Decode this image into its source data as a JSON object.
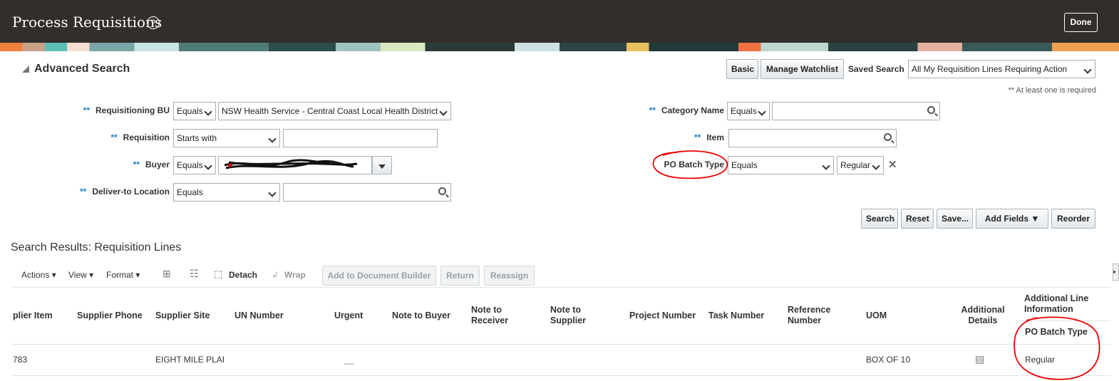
{
  "header": {
    "title": "Process Requisitions",
    "done_label": "Done"
  },
  "search": {
    "title": "Advanced Search",
    "basic_label": "Basic",
    "watchlist_label": "Manage Watchlist",
    "saved_search_label": "Saved Search",
    "saved_search_value": "All My Requisition Lines Requiring Action",
    "required_note": "** At least one is required",
    "required_marker": "**",
    "fields": {
      "req_bu": {
        "label": "Requisitioning BU",
        "operator": "Equals",
        "value": "NSW Health Service - Central Coast Local Health District"
      },
      "requisition": {
        "label": "Requisition",
        "operator": "Starts with",
        "value": ""
      },
      "buyer": {
        "label": "Buyer",
        "operator": "Equals",
        "value": ""
      },
      "deliver_to": {
        "label": "Deliver-to Location",
        "operator": "Equals",
        "value": ""
      },
      "category": {
        "label": "Category Name",
        "operator": "Equals",
        "value": ""
      },
      "item": {
        "label": "Item",
        "value": ""
      },
      "po_batch": {
        "label": "PO Batch Type",
        "operator": "Equals",
        "value": "Regular"
      }
    },
    "buttons": {
      "search": "Search",
      "reset": "Reset",
      "save": "Save...",
      "add_fields": "Add Fields",
      "reorder": "Reorder"
    }
  },
  "results": {
    "title": "Search Results: Requisition Lines",
    "toolbar": {
      "actions": "Actions",
      "view": "View",
      "format": "Format",
      "detach": "Detach",
      "wrap": "Wrap",
      "add_doc_builder": "Add to Document Builder",
      "return": "Return",
      "reassign": "Reassign"
    },
    "columns": [
      "plier Item",
      "Supplier Phone",
      "Supplier Site",
      "UN Number",
      "Urgent",
      "Note to Buyer",
      "Note to Receiver",
      "Note to Supplier",
      "Project Number",
      "Task Number",
      "Reference Number",
      "UOM",
      "Additional Details",
      "Additional Line Information",
      "PO Batch Type"
    ],
    "row": {
      "supplier_item": "783",
      "supplier_site": "EIGHT MILE PLAI",
      "urgent": "__",
      "uom": "BOX OF 10",
      "po_batch_type": "Regular"
    }
  }
}
